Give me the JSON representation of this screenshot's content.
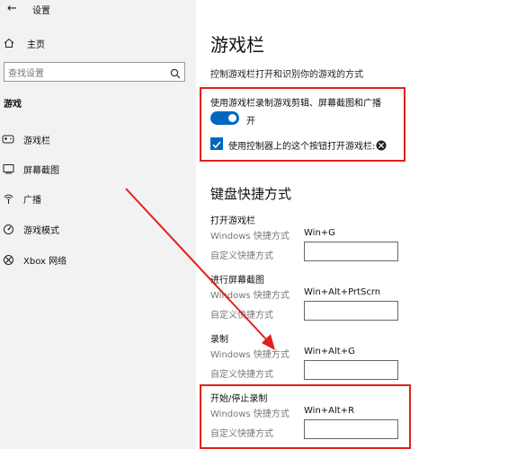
{
  "window": {
    "back_glyph": "←",
    "title": "设置"
  },
  "sidebar": {
    "home_label": "主页",
    "search": {
      "placeholder": "查找设置"
    },
    "section_title": "游戏",
    "items": [
      {
        "label": "游戏栏",
        "icon": "game-bar-icon"
      },
      {
        "label": "屏幕截图",
        "icon": "captures-icon"
      },
      {
        "label": "广播",
        "icon": "broadcast-icon"
      },
      {
        "label": "游戏模式",
        "icon": "game-mode-icon"
      },
      {
        "label": "Xbox 网络",
        "icon": "xbox-icon"
      }
    ]
  },
  "main": {
    "title": "游戏栏",
    "subtitle": "控制游戏栏打开和识别你的游戏的方式",
    "record_setting": {
      "label": "使用游戏栏录制游戏剪辑、屏幕截图和广播",
      "toggle_state": "开",
      "toggle_on": true
    },
    "controller_setting": {
      "label": "使用控制器上的这个按钮打开游戏栏:",
      "checked": true
    },
    "keyboard_section": {
      "title": "键盘快捷方式",
      "windows_label": "Windows 快捷方式",
      "custom_label": "自定义快捷方式",
      "groups": [
        {
          "title": "打开游戏栏",
          "windows_shortcut": "Win+G",
          "custom_value": ""
        },
        {
          "title": "进行屏幕截图",
          "windows_shortcut": "Win+Alt+PrtScrn",
          "custom_value": ""
        },
        {
          "title": "录制",
          "windows_shortcut": "Win+Alt+G",
          "custom_value": ""
        },
        {
          "title": "开始/停止录制",
          "windows_shortcut": "Win+Alt+R",
          "custom_value": ""
        }
      ]
    }
  },
  "colors": {
    "accent": "#0067c0",
    "annotation": "#e0201a",
    "sidebar_bg": "#f2f2f2"
  }
}
